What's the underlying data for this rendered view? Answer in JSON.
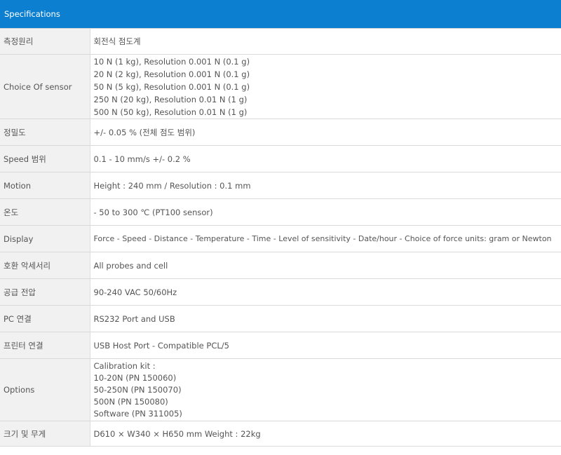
{
  "header": {
    "title": "Specifications"
  },
  "rows": [
    {
      "label": "측정원리",
      "lines": [
        "회전식 점도계"
      ]
    },
    {
      "label": "Choice Of sensor",
      "lines": [
        "10 N (1 kg), Resolution 0.001 N (0.1 g)",
        "20 N (2 kg), Resolution 0.001 N (0.1 g)",
        "50 N (5 kg), Resolution 0.001 N (0.1 g)",
        "250 N (20 kg), Resolution 0.01 N (1 g)",
        "500 N (50 kg), Resolution 0.01 N (1 g)"
      ]
    },
    {
      "label": "정밀도",
      "lines": [
        "+/- 0.05 % (전체 점도 범위)"
      ]
    },
    {
      "label": "Speed 범위",
      "lines": [
        "0.1 - 10 mm/s +/- 0.2 %"
      ]
    },
    {
      "label": "Motion",
      "lines": [
        "Height : 240 mm / Resolution : 0.1 mm"
      ]
    },
    {
      "label": "온도",
      "lines": [
        "- 50 to 300 ℃ (PT100 sensor)"
      ]
    },
    {
      "label": "Display",
      "lines": [
        "Force - Speed - Distance - Temperature - Time - Level of sensitivity - Date/hour - Choice of force units: gram or Newton"
      ]
    },
    {
      "label": "호환 악세서리",
      "lines": [
        "All probes and cell"
      ]
    },
    {
      "label": "공급 전압",
      "lines": [
        "90-240 VAC 50/60Hz"
      ]
    },
    {
      "label": "PC 연결",
      "lines": [
        "RS232 Port and USB"
      ]
    },
    {
      "label": "프린터 연결",
      "lines": [
        "USB Host Port - Compatible PCL/5"
      ]
    },
    {
      "label": "Options",
      "lines": [
        "Calibration kit :",
        "10-20N (PN 150060)",
        "50-250N (PN 150070)",
        "500N (PN 150080)",
        "Software (PN 311005)"
      ]
    },
    {
      "label": "크기 및 무게",
      "lines": [
        "D610 × W340 × H650 mm Weight : 22kg"
      ]
    }
  ]
}
